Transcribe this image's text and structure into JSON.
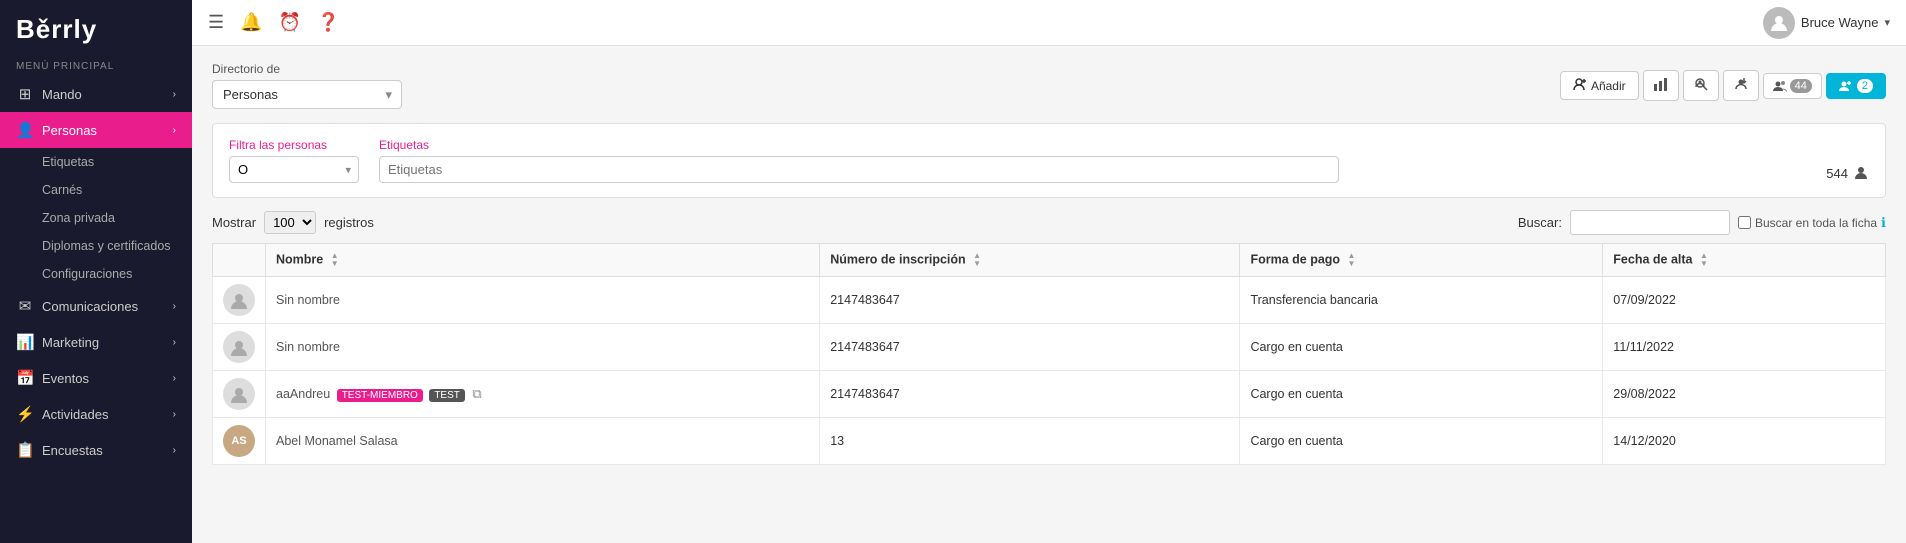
{
  "app": {
    "logo": "Běrrly",
    "section_label": "MENÚ PRINCIPAL"
  },
  "sidebar": {
    "items": [
      {
        "id": "mando",
        "label": "Mando",
        "icon": "⊞",
        "has_children": true,
        "active": false
      },
      {
        "id": "personas",
        "label": "Personas",
        "icon": "👤",
        "has_children": true,
        "active": true
      },
      {
        "id": "comunicaciones",
        "label": "Comunicaciones",
        "icon": "✉",
        "has_children": true,
        "active": false
      },
      {
        "id": "marketing",
        "label": "Marketing",
        "icon": "📊",
        "has_children": true,
        "active": false
      },
      {
        "id": "eventos",
        "label": "Eventos",
        "icon": "📅",
        "has_children": true,
        "active": false
      },
      {
        "id": "actividades",
        "label": "Actividades",
        "icon": "⚡",
        "has_children": true,
        "active": false
      },
      {
        "id": "encuestas",
        "label": "Encuestas",
        "icon": "📋",
        "has_children": true,
        "active": false
      }
    ],
    "sub_items": [
      {
        "label": "Etiquetas"
      },
      {
        "label": "Carnés"
      },
      {
        "label": "Zona privada"
      },
      {
        "label": "Diplomas y certificados"
      },
      {
        "label": "Configuraciones"
      }
    ]
  },
  "topbar": {
    "icons": [
      "hamburger",
      "bell",
      "clock",
      "help"
    ],
    "user": {
      "name": "Bruce Wayne",
      "caret": "▾"
    }
  },
  "directory": {
    "label": "Directorio de",
    "select_value": "Personas",
    "select_options": [
      "Personas"
    ]
  },
  "toolbar": {
    "add_label": "Añadir",
    "chart_icon": "📈",
    "search_icon": "🔍",
    "import_icon": "⬇",
    "badge_44_icon": "👥",
    "badge_44": "44",
    "badge_2_icon": "👤",
    "badge_2": "2"
  },
  "filters": {
    "filter_label": "Filtra las personas",
    "filter_value": "O",
    "tags_label": "Etiquetas",
    "tags_placeholder": "Etiquetas",
    "total_count": "544",
    "person_icon": "👤"
  },
  "table_controls": {
    "show_label": "Mostrar",
    "records_value": "100",
    "records_label": "registros",
    "search_label": "Buscar:",
    "full_record_label": "Buscar en toda la ficha"
  },
  "table": {
    "columns": [
      {
        "id": "avatar",
        "label": ""
      },
      {
        "id": "nombre",
        "label": "Nombre"
      },
      {
        "id": "inscripcion",
        "label": "Número de inscripción"
      },
      {
        "id": "pago",
        "label": "Forma de pago"
      },
      {
        "id": "alta",
        "label": "Fecha de alta"
      }
    ],
    "rows": [
      {
        "avatar_type": "default",
        "avatar_initials": "",
        "name": "Sin nombre",
        "name_color": "normal",
        "tags": [],
        "has_copy": false,
        "inscripcion": "2147483647",
        "pago": "Transferencia bancaria",
        "alta": "07/09/2022"
      },
      {
        "avatar_type": "default",
        "avatar_initials": "",
        "name": "Sin nombre",
        "name_color": "normal",
        "tags": [],
        "has_copy": false,
        "inscripcion": "2147483647",
        "pago": "Cargo en cuenta",
        "alta": "11/11/2022"
      },
      {
        "avatar_type": "default",
        "avatar_initials": "",
        "name": "aaAndreu",
        "name_suffix": "TEST-MIEMBRO",
        "tag_miembro": "TEST-MIEMBRO",
        "tag_test": "TEST",
        "name_color": "pink",
        "has_copy": true,
        "inscripcion": "2147483647",
        "pago": "Cargo en cuenta",
        "alta": "29/08/2022"
      },
      {
        "avatar_type": "photo",
        "avatar_initials": "AS",
        "name": "Abel Monamel Salasa",
        "name_color": "normal",
        "tags": [],
        "has_copy": false,
        "inscripcion": "13",
        "pago": "Cargo en cuenta",
        "alta": "14/12/2020"
      }
    ]
  }
}
